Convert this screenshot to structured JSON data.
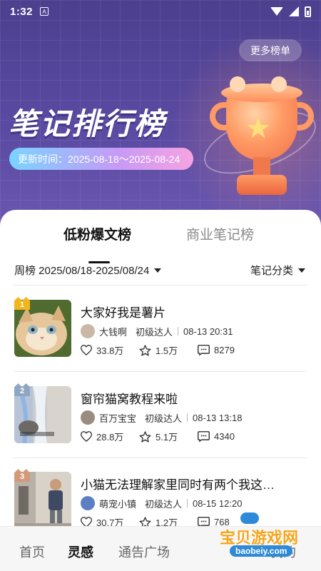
{
  "status_bar": {
    "time": "1:32"
  },
  "hero": {
    "more_button": "更多榜单",
    "title": "笔记排行榜",
    "update_time": "更新时间：2025-08-18～2025-08-24"
  },
  "tabs": [
    {
      "label": "低粉爆文榜",
      "active": true
    },
    {
      "label": "商业笔记榜",
      "active": false
    }
  ],
  "filters": {
    "period": "周榜 2025/08/18-2025/08/24",
    "category": "笔记分类"
  },
  "notes": [
    {
      "rank": "1",
      "rank_color": "#f2b51c",
      "title": "大家好我是薯片",
      "author": "大钱啊",
      "level": "初级达人",
      "time": "08-13 20:31",
      "likes": "33.8万",
      "favorites": "1.5万",
      "comments": "8279"
    },
    {
      "rank": "2",
      "rank_color": "#8fa6c2",
      "title": "窗帘猫窝教程来啦",
      "author": "百万宝宝",
      "level": "初级达人",
      "time": "08-13 13:18",
      "likes": "28.8万",
      "favorites": "5.1万",
      "comments": "4340"
    },
    {
      "rank": "3",
      "rank_color": "#d39a78",
      "title": "小猫无法理解家里同时有两个我这…",
      "author": "萌宠小镇",
      "level": "初级达人",
      "time": "08-15 12:20",
      "likes": "30.7万",
      "favorites": "1.2万",
      "comments": "768"
    }
  ],
  "bottom_nav": [
    {
      "label": "首页",
      "active": false
    },
    {
      "label": "灵感",
      "active": true
    },
    {
      "label": "通告广场",
      "active": false
    },
    {
      "label": "我的",
      "active": false
    }
  ],
  "watermark": {
    "text": "宝贝游戏网",
    "url": "baobeiy.com"
  },
  "colors": {
    "accent": "#5a4aa2",
    "trophy": "#ff9a64"
  }
}
